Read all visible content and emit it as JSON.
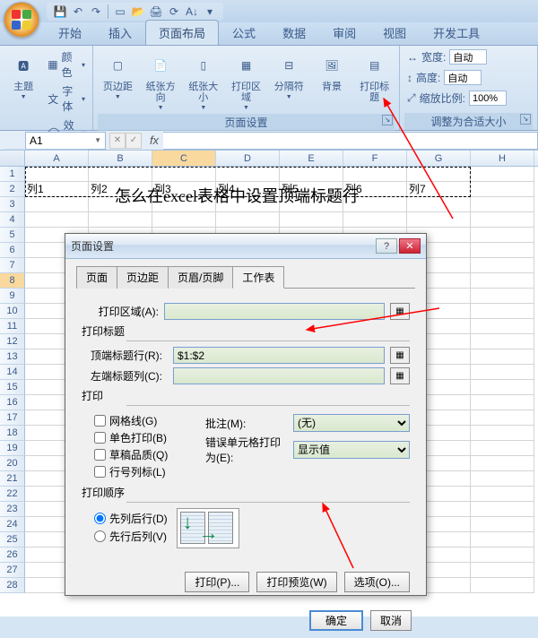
{
  "qat": {
    "items": [
      "save",
      "undo",
      "redo",
      "new",
      "open",
      "print",
      "refresh"
    ]
  },
  "ribbon": {
    "tabs": [
      "开始",
      "插入",
      "页面布局",
      "公式",
      "数据",
      "审阅",
      "视图",
      "开发工具"
    ],
    "active": 2,
    "groups": {
      "themes": {
        "title": "主题",
        "theme_btn": "主题",
        "colors": "颜色",
        "fonts": "字体",
        "effects": "效果"
      },
      "page_setup": {
        "title": "页面设置",
        "margins": "页边距",
        "orientation": "纸张方向",
        "size": "纸张大小",
        "print_area": "打印区域",
        "breaks": "分隔符",
        "background": "背景",
        "print_titles": "打印标题"
      },
      "scale": {
        "title": "调整为合适大小",
        "width_lbl": "宽度:",
        "width_val": "自动",
        "height_lbl": "高度:",
        "height_val": "自动",
        "scale_lbl": "缩放比例:",
        "scale_val": "100%"
      }
    }
  },
  "namebox": "A1",
  "grid": {
    "cols": [
      "A",
      "B",
      "C",
      "D",
      "E",
      "F",
      "G",
      "H"
    ],
    "title_text": "怎么在excel表格中设置顶端标题行",
    "row2": [
      "列1",
      "列2",
      "列3",
      "列4",
      "列5",
      "列6",
      "列7",
      ""
    ]
  },
  "dialog": {
    "title": "页面设置",
    "tabs": [
      "页面",
      "页边距",
      "页眉/页脚",
      "工作表"
    ],
    "active": 3,
    "print_area_lbl": "打印区域(A):",
    "print_area_val": "",
    "print_titles_section": "打印标题",
    "rows_repeat_lbl": "顶端标题行(R):",
    "rows_repeat_val": "$1:$2",
    "cols_repeat_lbl": "左端标题列(C):",
    "cols_repeat_val": "",
    "print_section": "打印",
    "gridlines": "网格线(G)",
    "bw": "单色打印(B)",
    "draft": "草稿品质(Q)",
    "rowcolhdr": "行号列标(L)",
    "comments_lbl": "批注(M):",
    "comments_val": "(无)",
    "errors_lbl": "错误单元格打印为(E):",
    "errors_val": "显示值",
    "order_section": "打印顺序",
    "down_then_over": "先列后行(D)",
    "over_then_down": "先行后列(V)",
    "btn_print": "打印(P)...",
    "btn_preview": "打印预览(W)",
    "btn_options": "选项(O)...",
    "btn_ok": "确定",
    "btn_cancel": "取消"
  }
}
